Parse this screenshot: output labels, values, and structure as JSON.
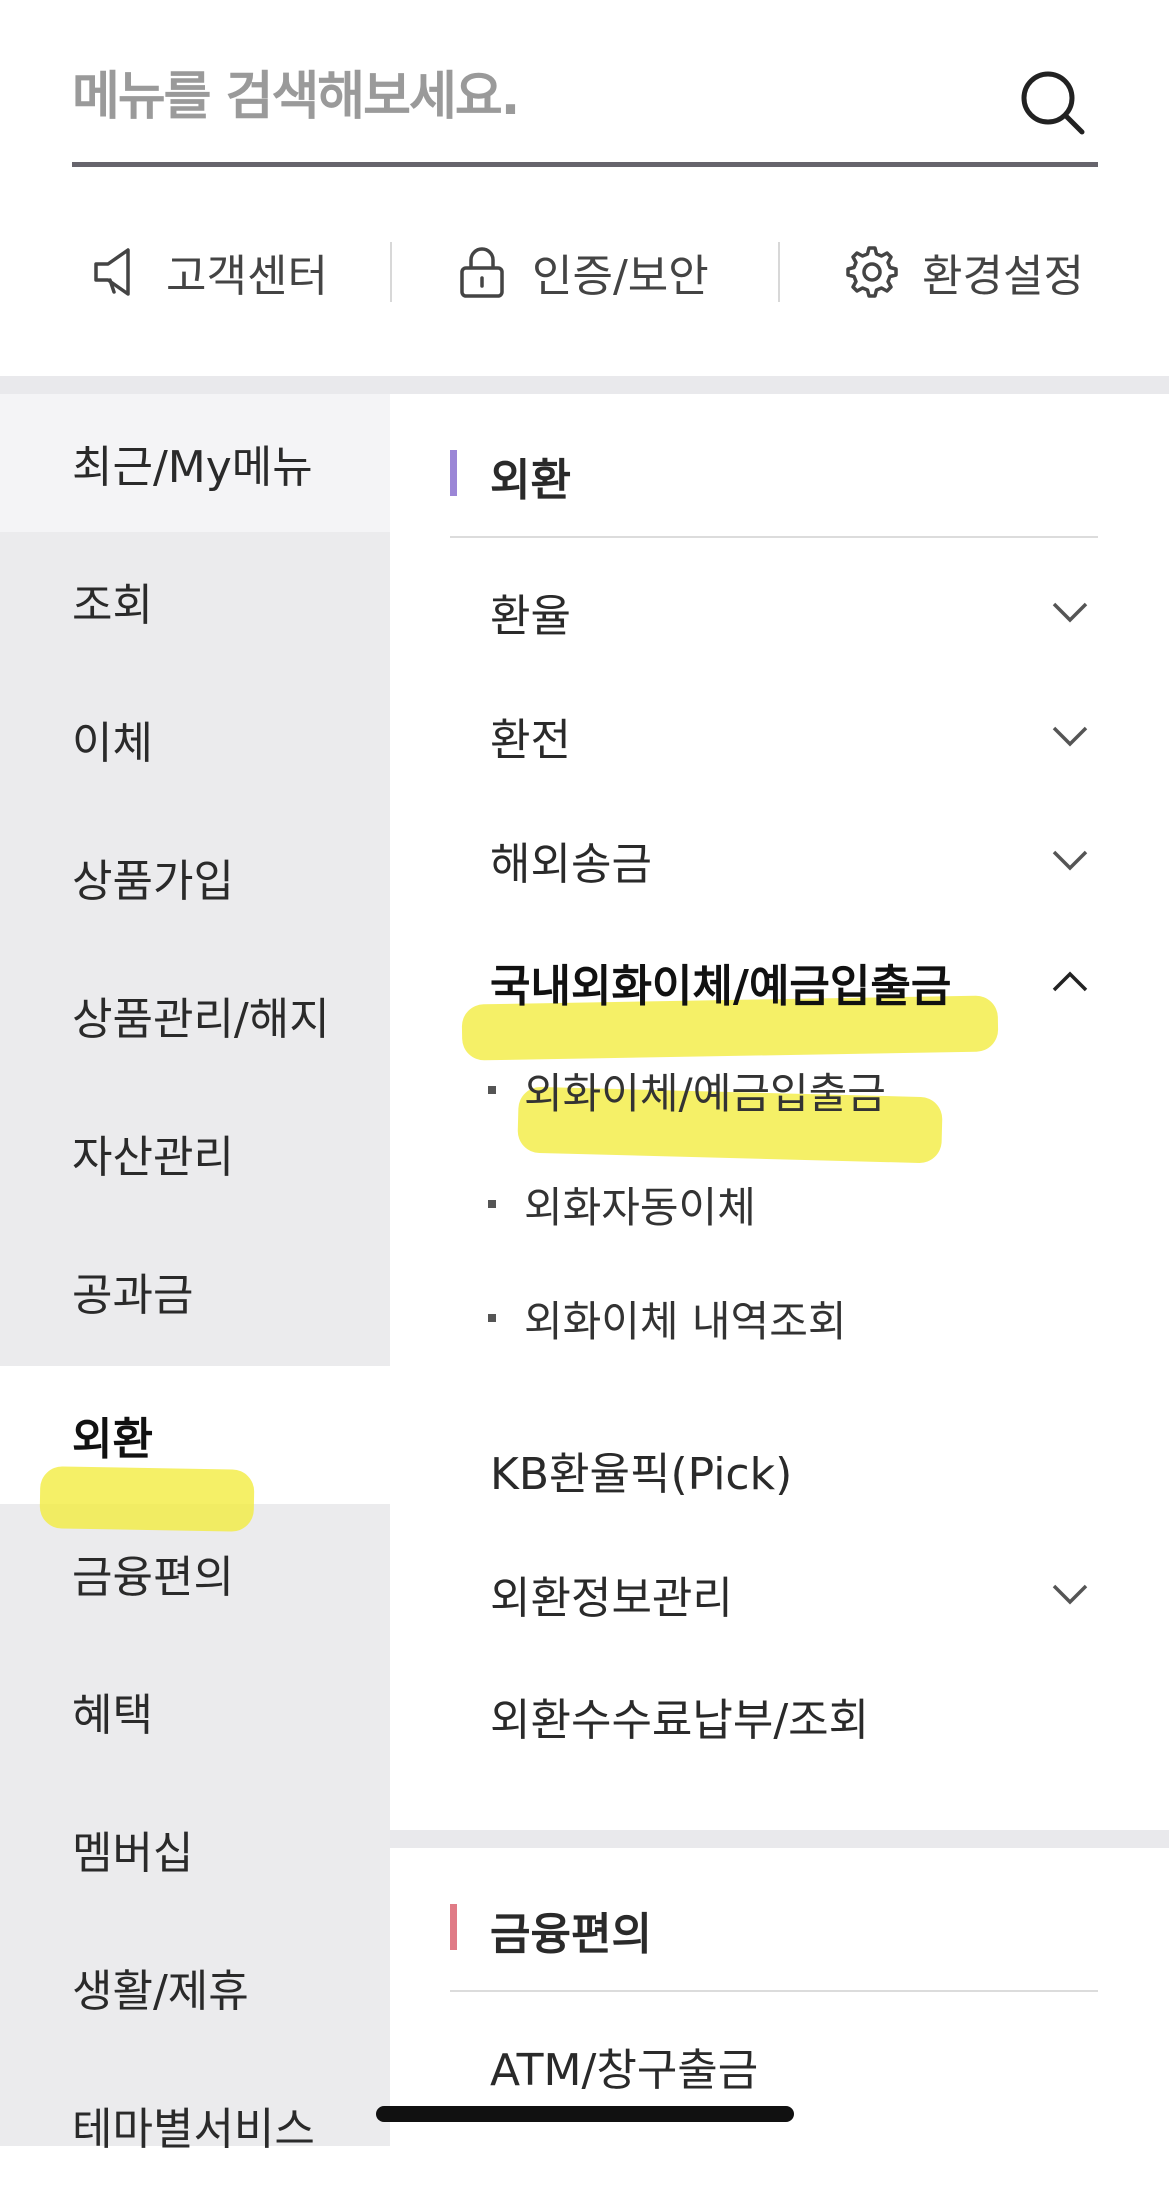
{
  "search": {
    "placeholder": "메뉴를 검색해보세요.",
    "value": ""
  },
  "quick_links": [
    {
      "label": "고객센터",
      "icon": "megaphone-icon"
    },
    {
      "label": "인증/보안",
      "icon": "lock-icon"
    },
    {
      "label": "환경설정",
      "icon": "gear-icon"
    }
  ],
  "left_nav": {
    "items": [
      {
        "label": "최근/My메뉴"
      },
      {
        "label": "조회"
      },
      {
        "label": "이체"
      },
      {
        "label": "상품가입"
      },
      {
        "label": "상품관리/해지"
      },
      {
        "label": "자산관리"
      },
      {
        "label": "공과금"
      },
      {
        "label": "외환",
        "active": true
      },
      {
        "label": "금융편의"
      },
      {
        "label": "혜택"
      },
      {
        "label": "멤버십"
      },
      {
        "label": "생활/제휴"
      },
      {
        "label": "테마별서비스"
      }
    ]
  },
  "sections": [
    {
      "title": "외환",
      "accent_color": "#9b86d6",
      "items": [
        {
          "label": "환율",
          "chevron": "down"
        },
        {
          "label": "환전",
          "chevron": "down"
        },
        {
          "label": "해외송금",
          "chevron": "down"
        },
        {
          "label": "국내외화이체/예금입출금",
          "chevron": "up",
          "expanded": true,
          "subitems": [
            {
              "label": "외화이체/예금입출금"
            },
            {
              "label": "외화자동이체"
            },
            {
              "label": "외화이체 내역조회"
            }
          ]
        },
        {
          "label": "KB환율픽(Pick)"
        },
        {
          "label": "외환정보관리",
          "chevron": "down"
        },
        {
          "label": "외환수수료납부/조회"
        }
      ]
    },
    {
      "title": "금융편의",
      "accent_color": "#e07b86",
      "items": [
        {
          "label": "ATM/창구출금"
        }
      ]
    }
  ],
  "colors": {
    "highlight": "#f2ec3c",
    "nav_background": "#ebebed",
    "search_underline": "#66646c"
  }
}
